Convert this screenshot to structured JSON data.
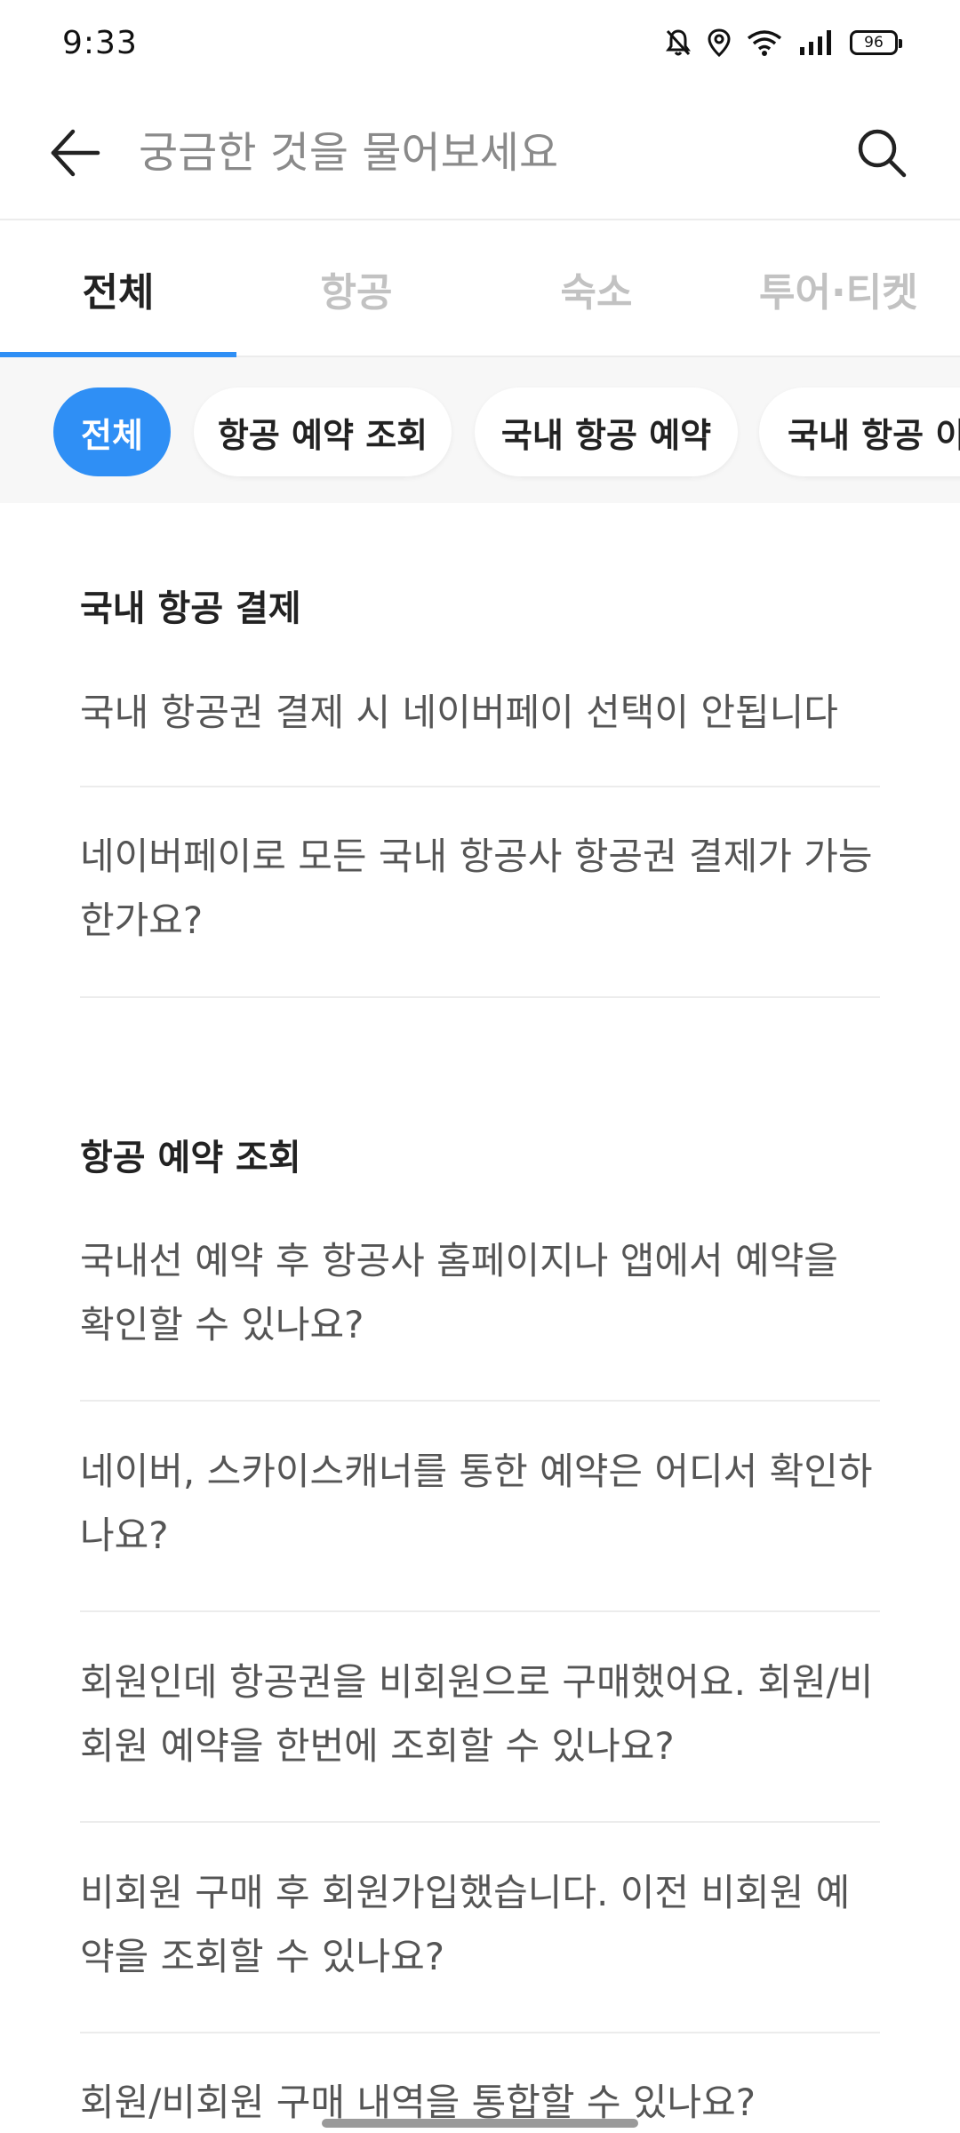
{
  "status_bar": {
    "time": "9:33",
    "battery": "96",
    "icons": [
      "bell-off-icon",
      "location-icon",
      "wifi-icon",
      "signal-icon",
      "battery-icon"
    ]
  },
  "search": {
    "placeholder": "궁금한 것을 물어보세요",
    "value": "",
    "back_icon": "back-arrow-icon",
    "search_icon": "search-icon"
  },
  "tabs": [
    {
      "label": "전체",
      "active": true
    },
    {
      "label": "항공",
      "active": false
    },
    {
      "label": "숙소",
      "active": false
    },
    {
      "label": "투어·티켓",
      "active": false
    }
  ],
  "chips": [
    {
      "label": "전체",
      "active": true
    },
    {
      "label": "항공 예약 조회",
      "active": false
    },
    {
      "label": "국내 항공 예약",
      "active": false
    },
    {
      "label": "국내 항공 이",
      "active": false
    }
  ],
  "sections": [
    {
      "title": "국내 항공 결제",
      "questions": [
        "국내 항공권 결제 시 네이버페이 선택이 안됩니다",
        "네이버페이로 모든 국내 항공사 항공권 결제가 가능한가요?"
      ]
    },
    {
      "title": "항공 예약 조회",
      "questions": [
        "국내선 예약 후 항공사 홈페이지나 앱에서 예약을 확인할 수 있나요?",
        "네이버, 스카이스캐너를 통한 예약은 어디서 확인하나요?",
        "회원인데 항공권을 비회원으로 구매했어요. 회원/비회원 예약을 한번에 조회할 수 있나요?",
        "비회원 구매 후 회원가입했습니다. 이전 비회원 예약을 조회할 수 있나요?",
        "회원/비회원 구매 내역을 통합할 수 있나요?"
      ]
    }
  ],
  "colors": {
    "accent": "#2f8ff5",
    "text_primary": "#222222",
    "text_secondary": "#555555",
    "tab_inactive": "#c2c2c2",
    "divider": "#ececec"
  }
}
